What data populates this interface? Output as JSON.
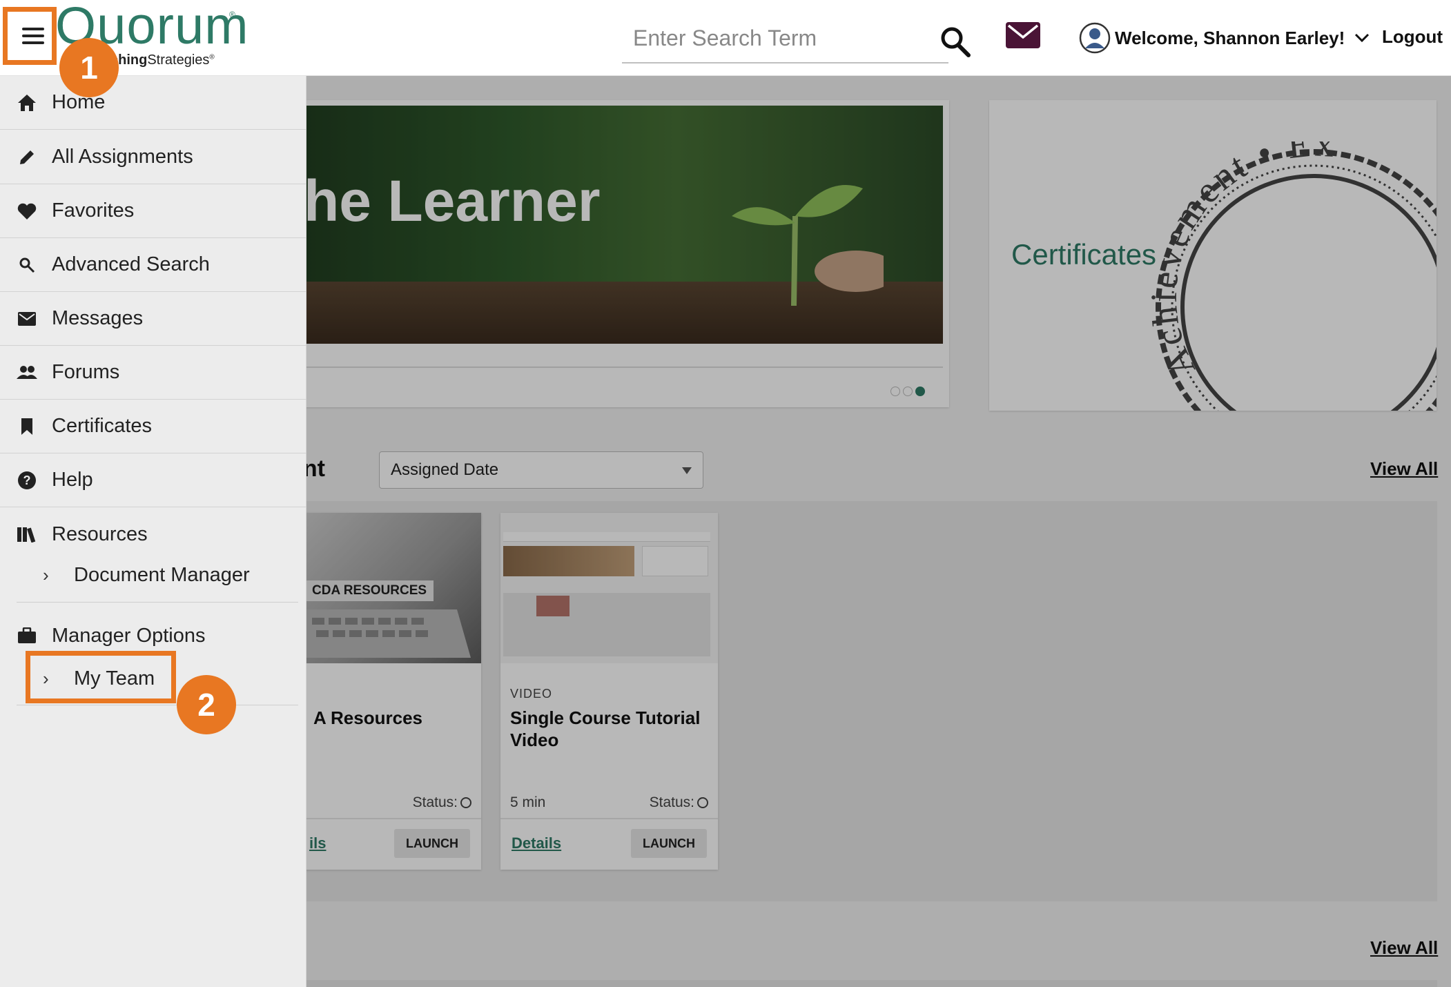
{
  "header": {
    "logo_text": "Quorum",
    "logo_reg": "®",
    "logo_sub_bold": "ching",
    "logo_sub_rest": "Strategies",
    "logo_sub_reg": "®",
    "search_placeholder": "Enter Search Term",
    "welcome": "Welcome, Shannon Earley!",
    "logout": "Logout"
  },
  "hero": {
    "title": "he Learner",
    "slide_count": 3,
    "active_slide": 3
  },
  "certificates_card": {
    "label": "Certificates",
    "seal_text": "Achievement • Ex"
  },
  "assignments": {
    "section_title": "ent",
    "sort_selected": "Assigned Date",
    "view_all": "View All",
    "cards": [
      {
        "thumb_caption": "CDA RESOURCES",
        "type": "",
        "title": "A Resources",
        "duration": "",
        "status_label": "Status:",
        "details": "ils",
        "launch": "LAUNCH"
      },
      {
        "thumb_caption": "",
        "type": "VIDEO",
        "title": "Single Course Tutorial Video",
        "duration": "5 min",
        "status_label": "Status:",
        "details": "Details",
        "launch": "LAUNCH"
      }
    ]
  },
  "second_section": {
    "view_all": "View All"
  },
  "sidebar": {
    "items": [
      {
        "label": "Home",
        "icon": "home-icon"
      },
      {
        "label": "All Assignments",
        "icon": "pencil-icon"
      },
      {
        "label": "Favorites",
        "icon": "heart-icon"
      },
      {
        "label": "Advanced Search",
        "icon": "search-icon"
      },
      {
        "label": "Messages",
        "icon": "mail-icon"
      },
      {
        "label": "Forums",
        "icon": "people-icon"
      },
      {
        "label": "Certificates",
        "icon": "bookmark-icon"
      },
      {
        "label": "Help",
        "icon": "help-icon"
      },
      {
        "label": "Resources",
        "icon": "books-icon"
      }
    ],
    "resources_sub": "Document Manager",
    "manager_options": "Manager Options",
    "manager_sub": "My Team"
  },
  "annotations": {
    "step1": "1",
    "step2": "2"
  },
  "colors": {
    "brand_green": "#2e7a66",
    "callout_orange": "#e87722"
  }
}
